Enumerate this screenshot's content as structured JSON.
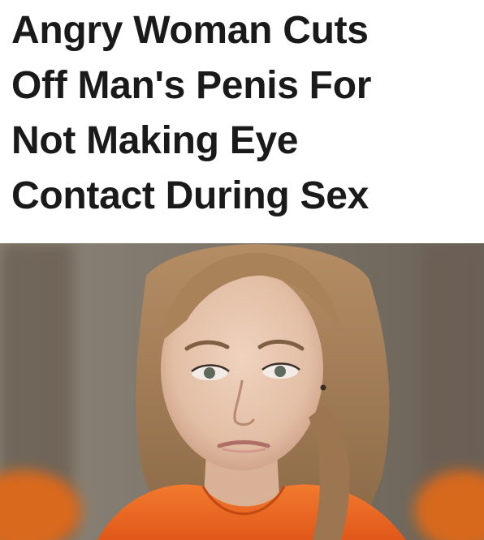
{
  "headline": {
    "lines": [
      "Angry Woman Cuts",
      "Off Man's Penis For",
      "Not Making Eye",
      "Contact During Sex"
    ]
  },
  "photo": {
    "subject": "mugshot-photo",
    "colors": {
      "background": "#7f776b",
      "hair": "#a47e58",
      "skin": "#e6c4ad",
      "jumpsuit": "#ee6a22"
    }
  }
}
